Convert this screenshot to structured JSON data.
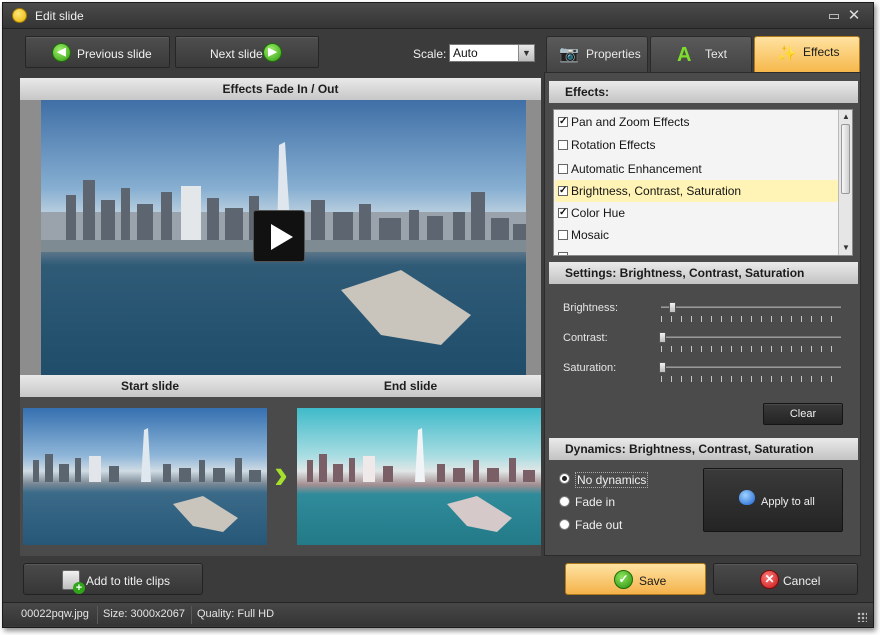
{
  "window": {
    "title": "Edit slide",
    "maximize_glyph": "▭",
    "close_glyph": "✕"
  },
  "toolbar": {
    "previous_label": "Previous slide",
    "next_label": "Next slide",
    "scale_label": "Scale:",
    "scale_value": "Auto"
  },
  "preview": {
    "header": "Effects Fade In / Out",
    "start_label": "Start slide",
    "end_label": "End slide"
  },
  "tabs": [
    {
      "label": "Properties",
      "icon": "camera-icon",
      "glyph": "📷",
      "active": false
    },
    {
      "label": "Text",
      "icon": "text-a-icon",
      "glyph": "A",
      "active": false
    },
    {
      "label": "Effects",
      "icon": "magic-effects-icon",
      "glyph": "✨",
      "active": true
    }
  ],
  "effects": {
    "header": "Effects:",
    "items": [
      {
        "label": "Pan and Zoom Effects",
        "checked": true,
        "highlight": false
      },
      {
        "label": "Rotation Effects",
        "checked": false,
        "highlight": false
      },
      {
        "label": "Automatic Enhancement",
        "checked": false,
        "highlight": false
      },
      {
        "label": "Brightness, Contrast, Saturation",
        "checked": true,
        "highlight": true
      },
      {
        "label": "Color Hue",
        "checked": true,
        "highlight": false
      },
      {
        "label": "Mosaic",
        "checked": false,
        "highlight": false
      }
    ]
  },
  "settings": {
    "header": "Settings: Brightness, Contrast, Saturation",
    "sliders": [
      {
        "label": "Brightness:",
        "value_fraction": 0.07
      },
      {
        "label": "Contrast:",
        "value_fraction": 0.0
      },
      {
        "label": "Saturation:",
        "value_fraction": 0.0
      }
    ],
    "clear_label": "Clear"
  },
  "dynamics": {
    "header": "Dynamics: Brightness, Contrast, Saturation",
    "options": [
      {
        "label": "No dynamics",
        "selected": true
      },
      {
        "label": "Fade in",
        "selected": false
      },
      {
        "label": "Fade out",
        "selected": false
      }
    ],
    "apply_label": "Apply to all"
  },
  "actions": {
    "add_title_label": "Add to title clips",
    "save_label": "Save",
    "cancel_label": "Cancel"
  },
  "status": {
    "filename": "00022pqw.jpg",
    "size": "Size: 3000x2067",
    "quality": "Quality: Full HD"
  },
  "colors": {
    "accent": "#f6b84c",
    "panel": "#3b3b3b",
    "highlight_row": "#fff3b5"
  }
}
